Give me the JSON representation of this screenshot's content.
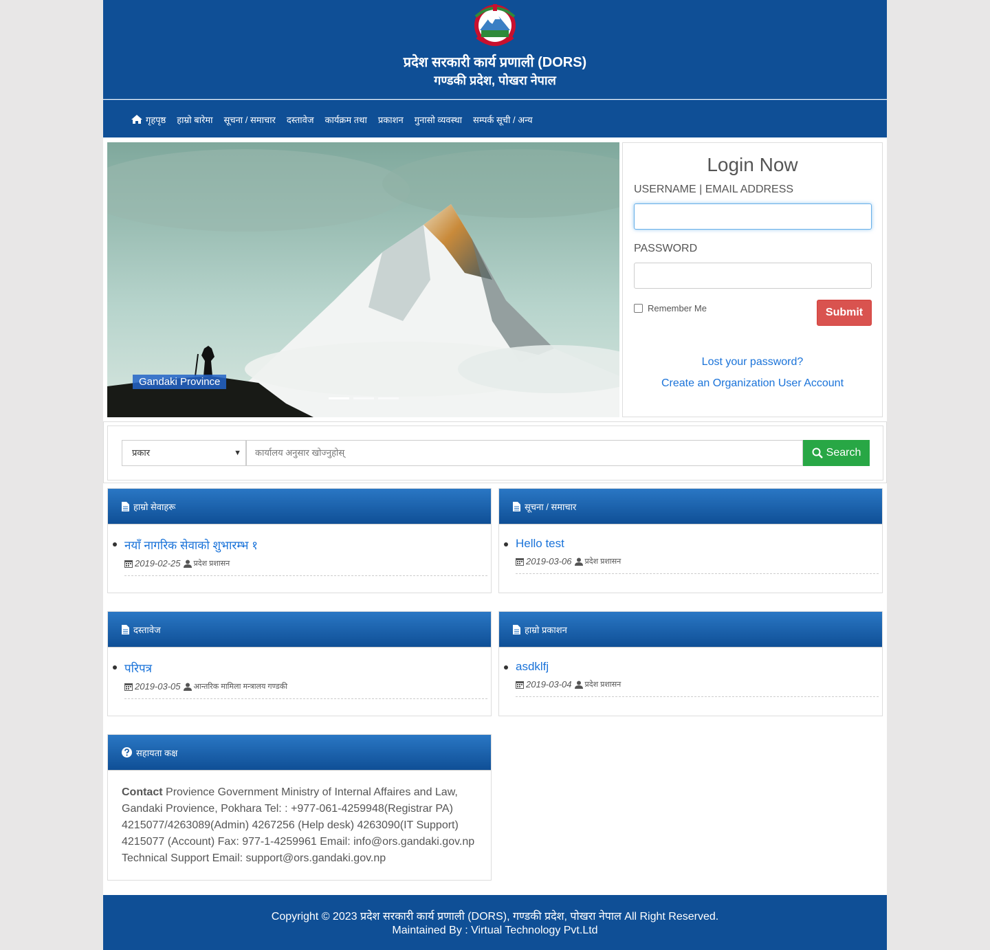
{
  "header": {
    "title": "प्रदेश सरकारी कार्य प्रणाली (DORS)",
    "subtitle": "गण्डकी प्रदेश, पोखरा नेपाल"
  },
  "nav": {
    "items": [
      {
        "label": "गृहपृष्ठ",
        "icon": "home-icon"
      },
      {
        "label": "हाम्रो बारेमा"
      },
      {
        "label": "सूचना / समाचार"
      },
      {
        "label": "दस्तावेज"
      },
      {
        "label": "कार्यक्रम तथा"
      },
      {
        "label": "प्रकाशन"
      },
      {
        "label": "गुनासो व्यवस्था"
      },
      {
        "label": "सम्पर्क सूची / अन्य"
      }
    ]
  },
  "slider": {
    "caption": "Gandaki Province",
    "slide_count": 3,
    "active_slide": 1
  },
  "login": {
    "title": "Login Now",
    "username_label": "USERNAME | EMAIL ADDRESS",
    "username_value": "",
    "password_label": "PASSWORD",
    "password_value": "",
    "remember_label": "Remember Me",
    "submit_label": "Submit",
    "lost_password": "Lost your password?",
    "create_account": "Create an Organization User Account"
  },
  "search": {
    "select_value": "प्रकार",
    "placeholder": "कार्यालय अनुसार खोज्नुहोस्",
    "button_label": "Search"
  },
  "cards": [
    {
      "heading": "हाम्रो सेवाहरू",
      "items": [
        {
          "title": "नयाँ नागरिक सेवाको शुभारम्भ १",
          "date": "2019-02-25",
          "author": "प्रदेश प्रशासन"
        }
      ]
    },
    {
      "heading": "सूचना / समाचार",
      "items": [
        {
          "title": "Hello test",
          "date": "2019-03-06",
          "author": "प्रदेश प्रशासन"
        }
      ]
    },
    {
      "heading": "दस्तावेज",
      "items": [
        {
          "title": "परिपत्र",
          "date": "2019-03-05",
          "author": "आन्तरिक मामिला मन्त्रालय गण्डकी"
        }
      ]
    },
    {
      "heading": "हाम्रो प्रकाशन",
      "items": [
        {
          "title": "asdklfj",
          "date": "2019-03-04",
          "author": "प्रदेश प्रशासन"
        }
      ]
    }
  ],
  "help": {
    "heading": "सहायता कक्ष",
    "contact_label": "Contact",
    "contact_text": "Provience Government Ministry of Internal Affaires and Law, Gandaki Provience, Pokhara Tel: : +977-061-4259948(Registrar PA) 4215077/4263089(Admin) 4267256 (Help desk) 4263090(IT Support) 4215077 (Account) Fax: 977-1-4259961 Email: info@ors.gandaki.gov.np Technical Support Email: support@ors.gandaki.gov.np"
  },
  "footer": {
    "copyright": "Copyright © 2023 प्रदेश सरकारी कार्य प्रणाली (DORS), गण्डकी प्रदेश, पोखरा नेपाल All Right Reserved.",
    "maintained": "Maintained By : Virtual Technology Pvt.Ltd"
  },
  "colors": {
    "brand_blue": "#0f4f96",
    "submit_red": "#d9534f",
    "search_green": "#28a745",
    "link_blue": "#1a73d9"
  }
}
